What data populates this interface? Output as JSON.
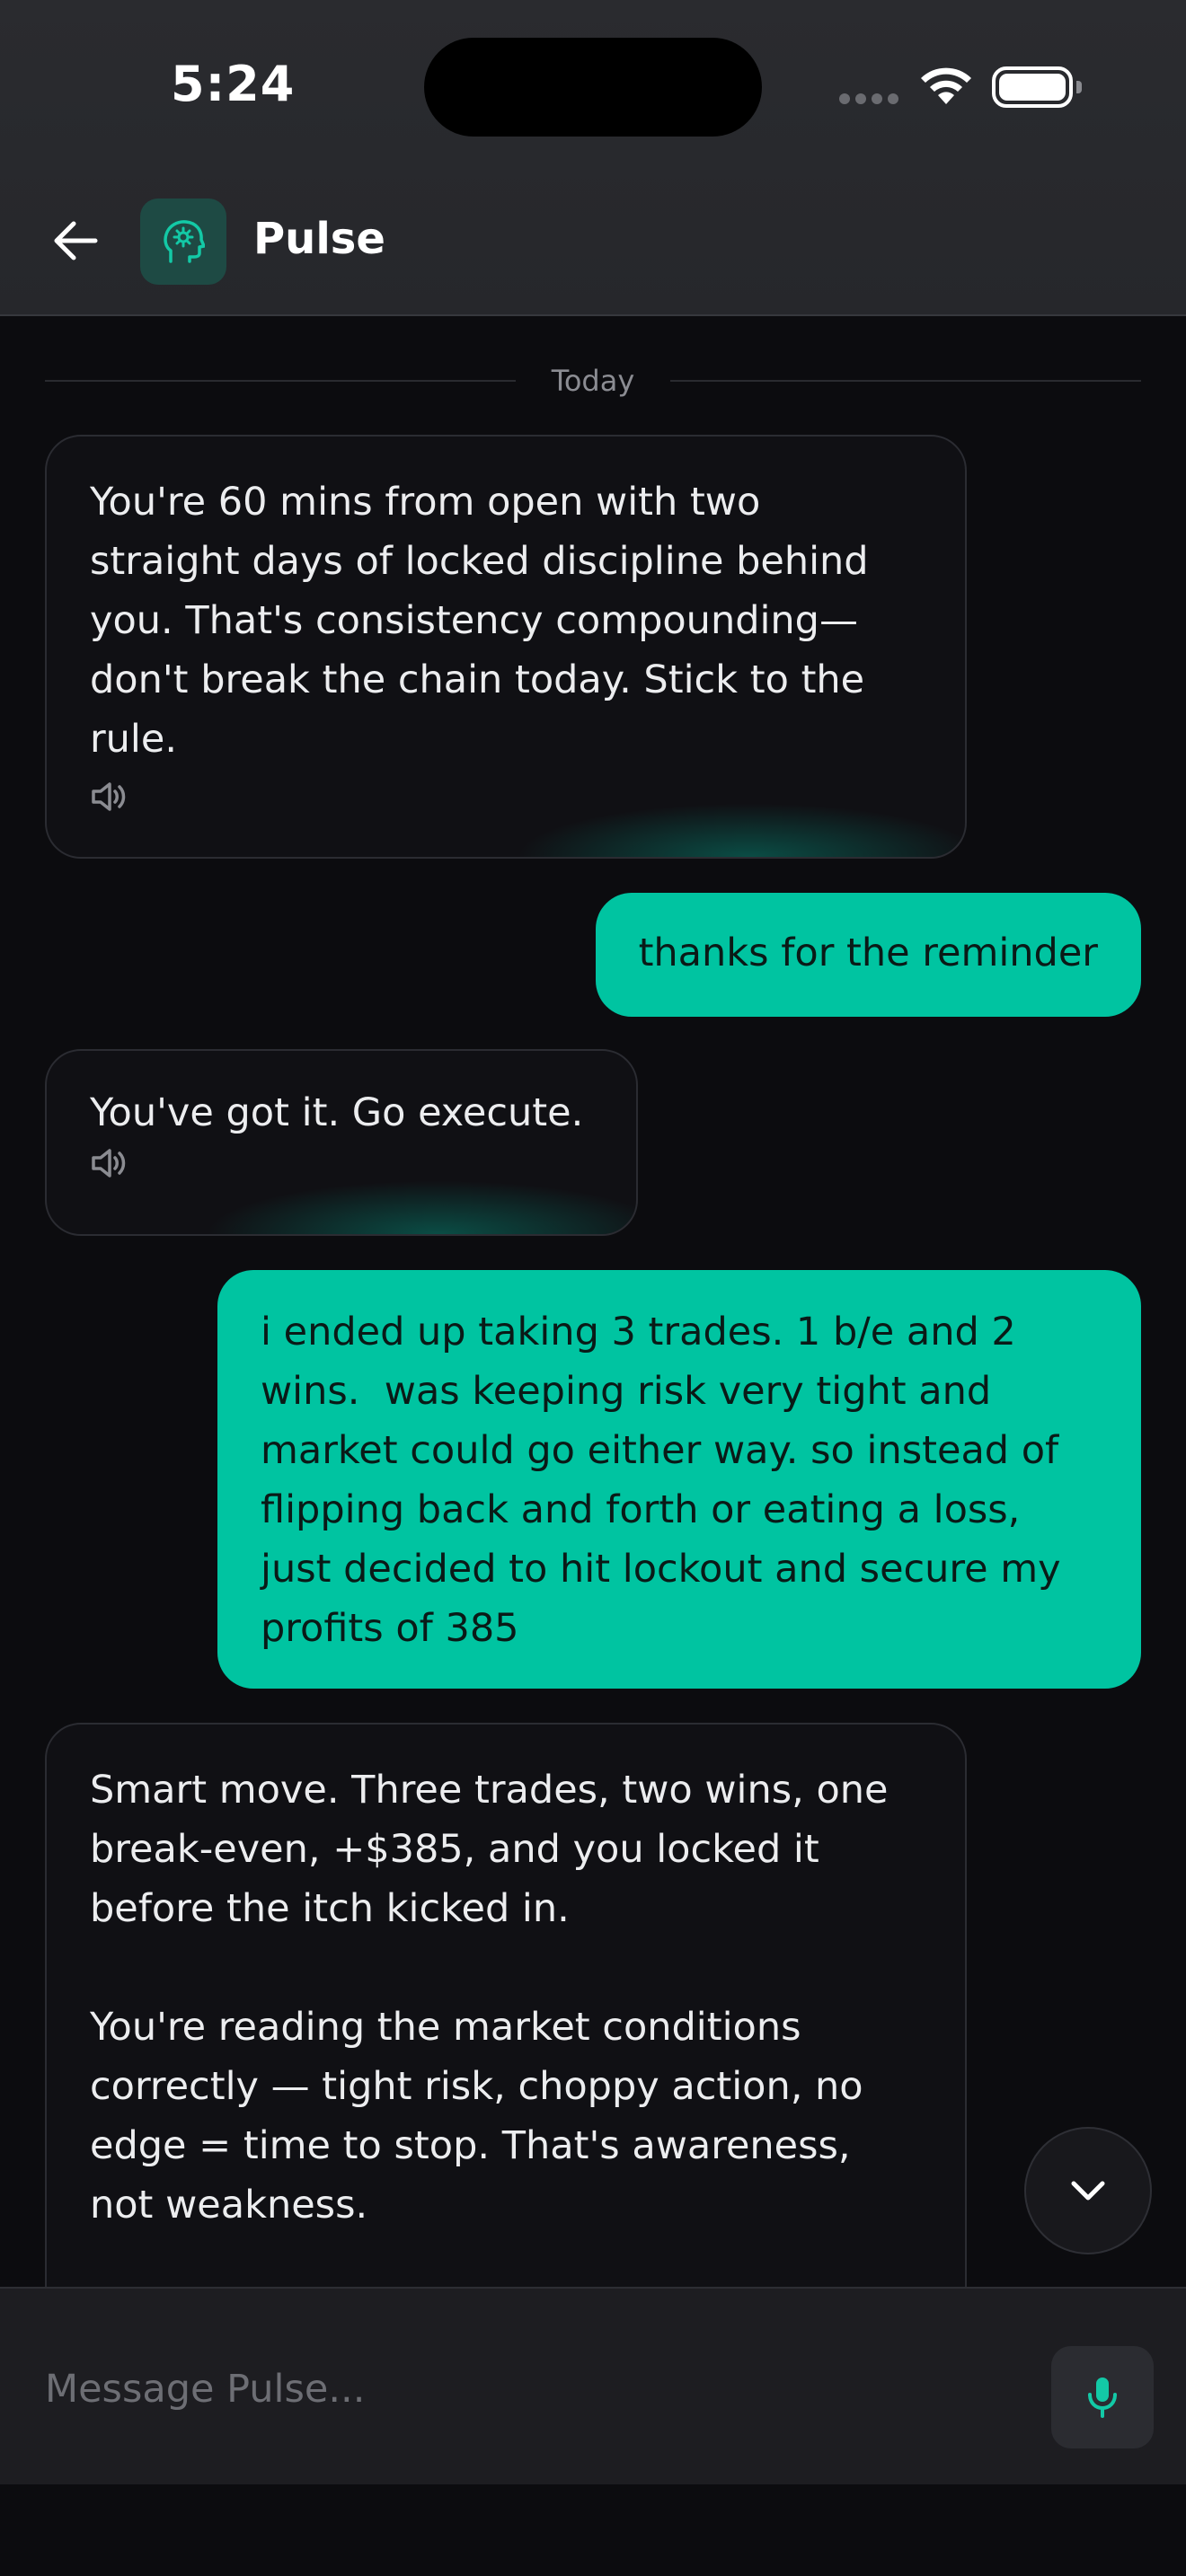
{
  "status_bar": {
    "time": "5:24"
  },
  "header": {
    "title": "Pulse"
  },
  "chat": {
    "date_divider": "Today",
    "messages": [
      {
        "role": "assistant",
        "text": "You're 60 mins from open with two straight days of locked discipline behind you. That's consistency compounding—don't break the chain today. Stick to the rule.",
        "icon": "speaker-icon"
      },
      {
        "role": "user",
        "text": "thanks for the reminder"
      },
      {
        "role": "assistant",
        "text": "You've got it. Go execute.",
        "icon": "speaker-icon"
      },
      {
        "role": "user",
        "text": "i ended up taking 3 trades. 1 b/e and 2 wins.  was keeping risk very tight and market could go either way. so instead of flipping back and forth or eating a loss, just decided to hit lockout and secure my profits of 385"
      },
      {
        "role": "assistant",
        "text": "Smart move. Three trades, two wins, one break-even, +$385, and you locked it before the itch kicked in.\n\nYou're reading the market conditions correctly — tight risk, choppy action, no edge = time to stop. That's awareness, not weakness."
      }
    ]
  },
  "composer": {
    "placeholder": "Message Pulse..."
  },
  "colors": {
    "accent": "#00c4a1",
    "background": "#0c0c0f",
    "header": "#26272b"
  }
}
